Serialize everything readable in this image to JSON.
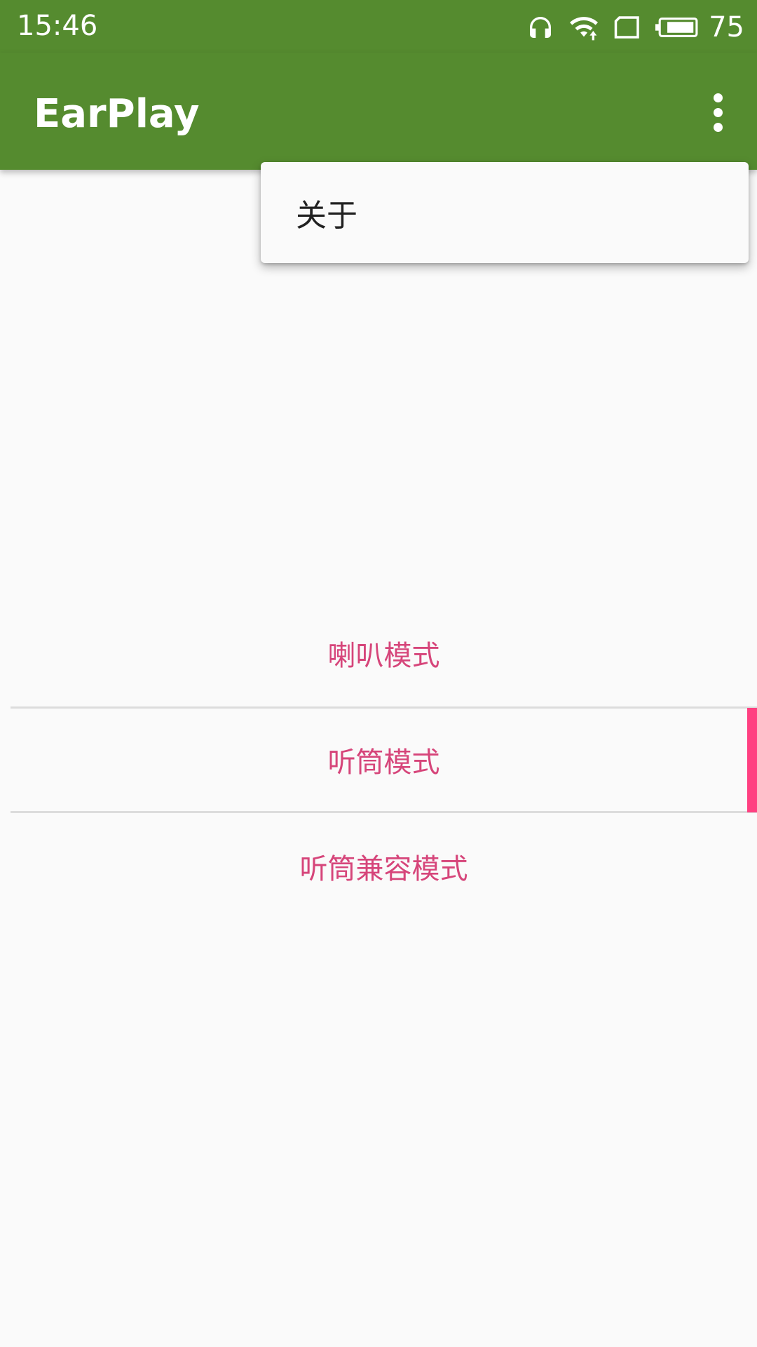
{
  "status_bar": {
    "time": "15:46",
    "battery": "75",
    "icons": [
      "headphones-icon",
      "wifi-icon",
      "sim-card-icon",
      "battery-icon"
    ]
  },
  "app_bar": {
    "title": "EarPlay",
    "overflow_icon": "more-vert-icon"
  },
  "popup_menu": {
    "items": [
      {
        "label": "关于"
      }
    ]
  },
  "modes": {
    "options": [
      {
        "label": "喇叭模式"
      },
      {
        "label": "听筒模式"
      },
      {
        "label": "听筒兼容模式"
      }
    ],
    "selected_index": 1
  },
  "colors": {
    "primary": "#558b2f",
    "accent": "#ff4081",
    "option_text": "#d6457a",
    "background": "#fafafa"
  }
}
